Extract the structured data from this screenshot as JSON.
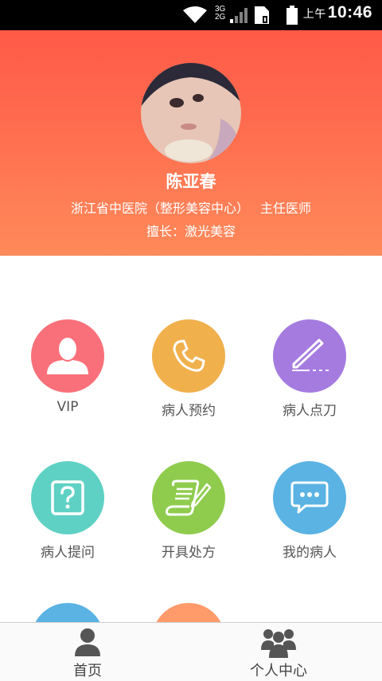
{
  "status_bar": {
    "network_label_top": "3G",
    "network_label_bottom": "2G",
    "ampm": "上午",
    "time": "10:46"
  },
  "profile": {
    "name": "陈亚春",
    "hospital": "浙江省中医院（整形美容中心）",
    "title": "主任医师",
    "specialty": "擅长：激光美容",
    "gradient_top": "#ff5a48",
    "gradient_bottom": "#ff8a5a"
  },
  "grid": {
    "items": [
      {
        "label": "VIP",
        "icon": "person-icon",
        "color": "#f9707a"
      },
      {
        "label": "病人预约",
        "icon": "phone-icon",
        "color": "#f0b04c"
      },
      {
        "label": "病人点刀",
        "icon": "scalpel-icon",
        "color": "#a57be0"
      },
      {
        "label": "病人提问",
        "icon": "question-icon",
        "color": "#5ed1c4"
      },
      {
        "label": "开具处方",
        "icon": "prescription-icon",
        "color": "#8fcc4d"
      },
      {
        "label": "我的病人",
        "icon": "chat-bubble-icon",
        "color": "#5ab3e3"
      },
      {
        "label": "",
        "icon": "partial-blue-icon",
        "color": "#5ab3e3"
      },
      {
        "label": "",
        "icon": "partial-orange-icon",
        "color": "#ff9a6a"
      }
    ]
  },
  "bottom_nav": {
    "home_label": "首页",
    "profile_label": "个人中心"
  }
}
